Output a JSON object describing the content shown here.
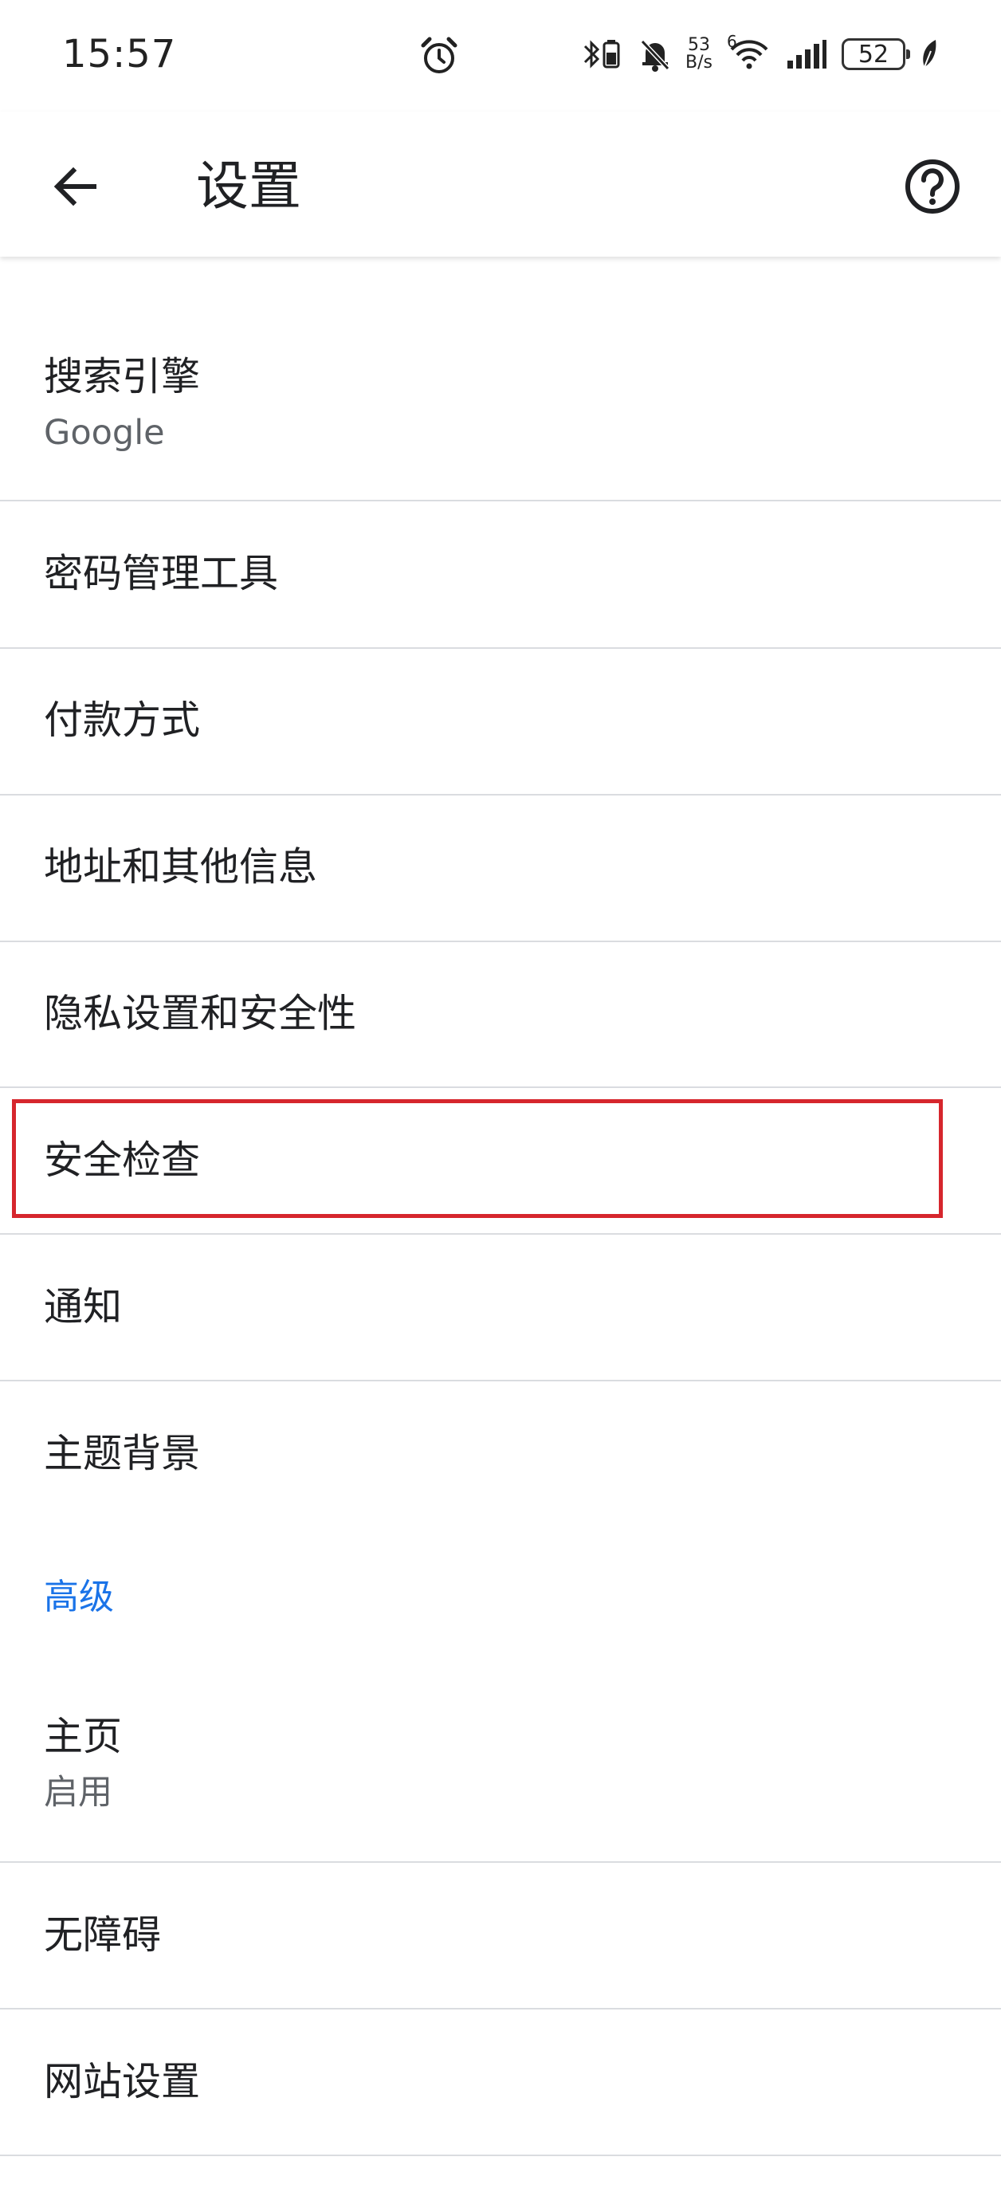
{
  "status_bar": {
    "time": "15:57",
    "net_speed_value": "53",
    "net_speed_unit": "B/s",
    "wifi_badge": "6",
    "battery": "52"
  },
  "header": {
    "title": "设置"
  },
  "items": [
    {
      "title": "搜索引擎",
      "subtitle": "Google"
    },
    {
      "title": "密码管理工具"
    },
    {
      "title": "付款方式"
    },
    {
      "title": "地址和其他信息"
    },
    {
      "title": "隐私设置和安全性"
    },
    {
      "title": "安全检查"
    },
    {
      "title": "通知"
    },
    {
      "title": "主题背景"
    }
  ],
  "advanced": {
    "header": "高级",
    "items": [
      {
        "title": "主页",
        "subtitle": "启用"
      },
      {
        "title": "无障碍"
      },
      {
        "title": "网站设置"
      }
    ]
  },
  "colors": {
    "accent": "#1a73e8",
    "highlight": "#d6262d",
    "divider": "#dadce0"
  }
}
